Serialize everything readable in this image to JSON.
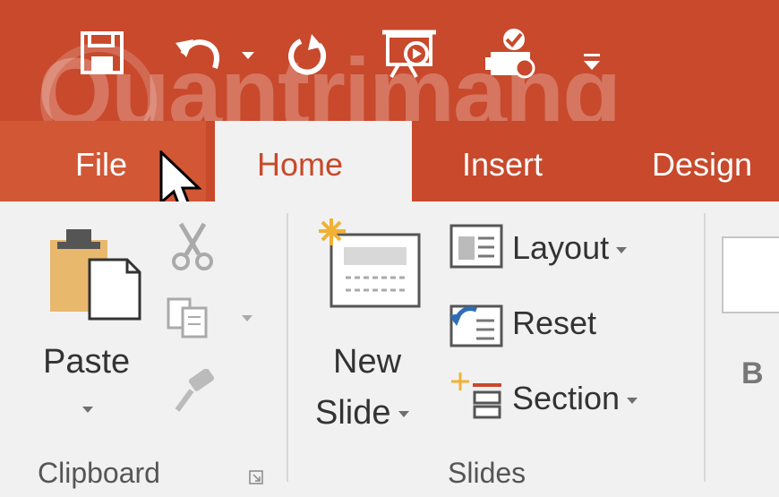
{
  "tabs": {
    "file": "File",
    "home": "Home",
    "insert": "Insert",
    "design": "Design"
  },
  "watermark": "Quantrimang",
  "clipboard": {
    "paste_label": "Paste",
    "group_label": "Clipboard"
  },
  "slides": {
    "new_slide_line1": "New",
    "new_slide_line2": "Slide",
    "layout_label": "Layout",
    "reset_label": "Reset",
    "section_label": "Section",
    "group_label": "Slides"
  },
  "font": {
    "bold_label": "B"
  },
  "colors": {
    "ribbon_accent": "#c8492c",
    "file_tab": "#d25735",
    "ribbon_bg": "#f1f1f1"
  }
}
